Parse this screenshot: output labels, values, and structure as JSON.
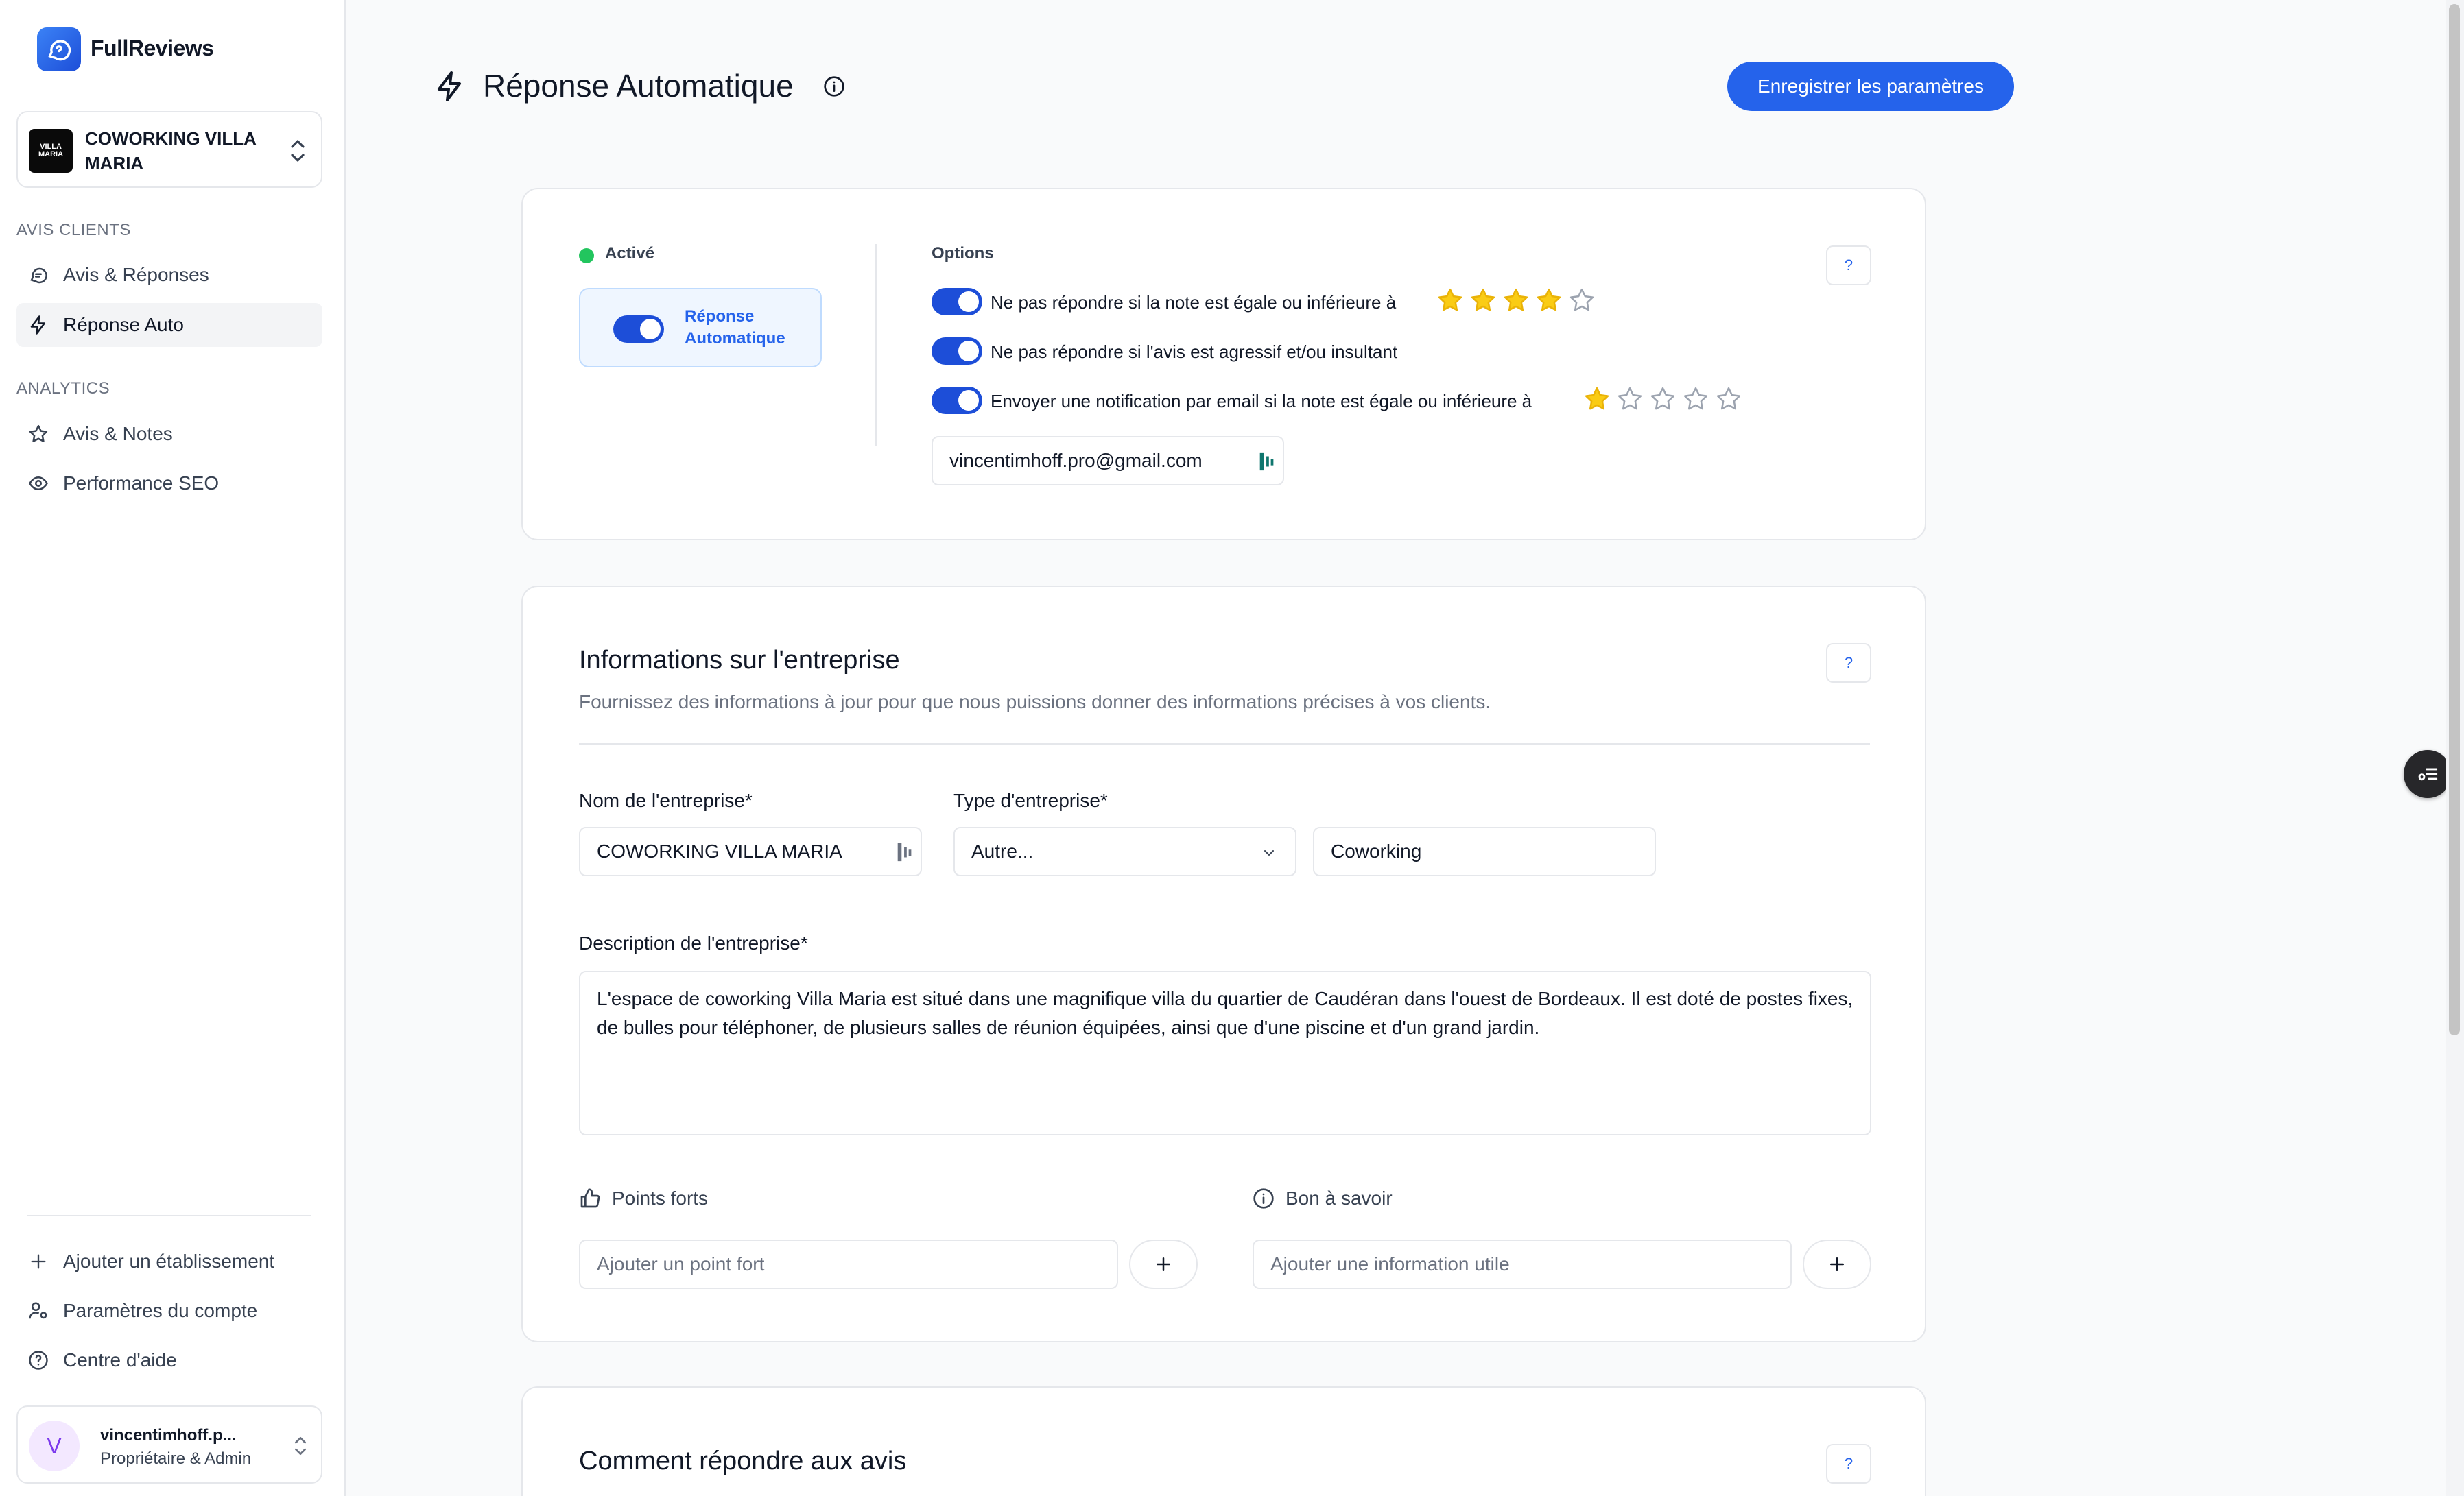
{
  "app": {
    "name": "FullReviews"
  },
  "business_select": {
    "name": "COWORKING VILLA MARIA",
    "logo_text": "VILLA MARIA"
  },
  "sidebar": {
    "sections": [
      {
        "label": "AVIS CLIENTS",
        "items": [
          {
            "label": "Avis & Réponses",
            "icon": "chat-icon"
          },
          {
            "label": "Réponse Auto",
            "icon": "bolt-icon",
            "active": true
          }
        ]
      },
      {
        "label": "ANALYTICS",
        "items": [
          {
            "label": "Avis & Notes",
            "icon": "star-icon"
          },
          {
            "label": "Performance SEO",
            "icon": "eye-icon"
          }
        ]
      }
    ],
    "bottom_items": [
      {
        "label": "Ajouter un établissement",
        "icon": "plus-icon"
      },
      {
        "label": "Paramètres du compte",
        "icon": "user-gear-icon"
      },
      {
        "label": "Centre d'aide",
        "icon": "help-circle-icon"
      }
    ],
    "user": {
      "initial": "V",
      "name": "vincentimhoff.p...",
      "role": "Propriétaire & Admin"
    }
  },
  "header": {
    "title": "Réponse Automatique",
    "save_label": "Enregistrer les paramètres"
  },
  "auto_reply_card": {
    "status": "Activé",
    "status_color": "#22c55e",
    "toggle_label": "Réponse Automatique",
    "options_label": "Options",
    "help_label": "?",
    "options": [
      {
        "text": "Ne pas répondre si la note est égale ou inférieure à",
        "enabled": true,
        "stars_filled": 4,
        "stars_total": 5
      },
      {
        "text": "Ne pas répondre si l'avis est agressif et/ou insultant",
        "enabled": true
      },
      {
        "text": "Envoyer une notification par email si la note est égale ou inférieure à",
        "enabled": true,
        "stars_filled": 1,
        "stars_total": 5
      }
    ],
    "email": "vincentimhoff.pro@gmail.com"
  },
  "business_info_card": {
    "title": "Informations sur l'entreprise",
    "subtitle": "Fournissez des informations à jour pour que nous puissions donner des informations précises à vos clients.",
    "help_label": "?",
    "name_label": "Nom de l'entreprise*",
    "name_value": "COWORKING VILLA MARIA",
    "type_label": "Type d'entreprise*",
    "type_value": "Autre...",
    "type_other_value": "Coworking",
    "description_label": "Description de l'entreprise*",
    "description_value": "L'espace de coworking Villa Maria est situé dans une magnifique villa du quartier de Caudéran dans l'ouest de Bordeaux. Il est doté de postes fixes, de bulles pour téléphoner, de plusieurs salles de réunion équipées, ainsi que d'une piscine et d'un grand jardin.",
    "strengths_label": "Points forts",
    "strengths_placeholder": "Ajouter un point fort",
    "good_to_know_label": "Bon à savoir",
    "good_to_know_placeholder": "Ajouter une information utile"
  },
  "reply_card": {
    "title": "Comment répondre aux avis",
    "help_label": "?"
  },
  "colors": {
    "accent": "#2563eb",
    "star": "#facc15"
  }
}
